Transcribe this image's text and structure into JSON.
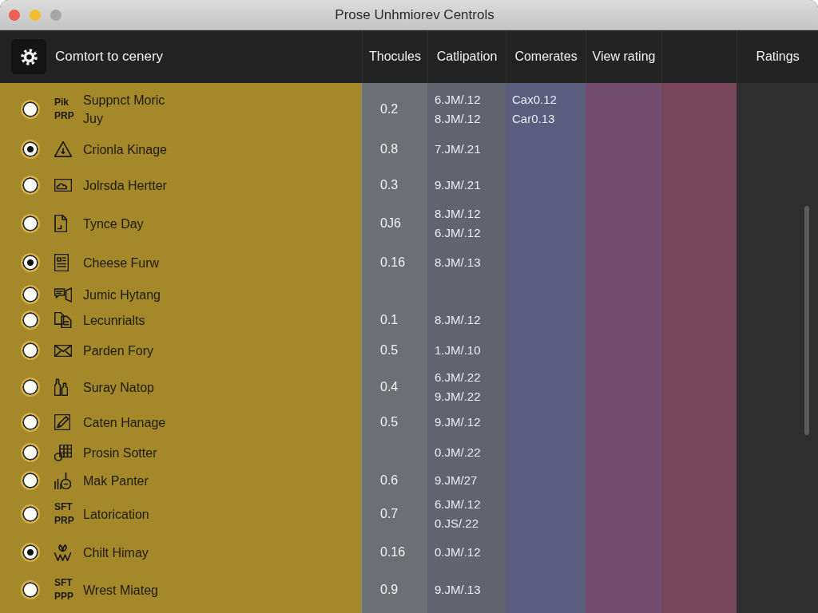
{
  "window": {
    "title": "Prose Unhmiorev Centrols"
  },
  "table": {
    "columns": [
      {
        "label": "Comtort to cenery",
        "color": "#a4882a"
      },
      {
        "label": "Thocules",
        "color": "#6c6f73"
      },
      {
        "label": "Catlipation",
        "color": "#61646f"
      },
      {
        "label": "Comerates",
        "color": "#5a5d7e"
      },
      {
        "label": "View rating",
        "color": "#724c6d"
      },
      {
        "color": "#77465b"
      },
      {
        "label": "Ratings",
        "color": "#2e2e2e"
      }
    ],
    "rows": [
      {
        "selected": false,
        "kind": "abbr",
        "abbr": [
          "Pik",
          "PRP"
        ],
        "name": "Suppnct Moric",
        "note": "Juy",
        "thocules": "0.2",
        "catlipation": [
          "6.JM/.12",
          "8.JM/.12"
        ],
        "comerates": [
          "Cax0.12",
          "Car0.13"
        ]
      },
      {
        "selected": true,
        "kind": "icon",
        "name": "Crionla Kinage",
        "thocules": "0.8",
        "catlipation": [
          "7.JM/.21"
        ]
      },
      {
        "selected": false,
        "kind": "icon",
        "name": "Jolrsda Hertter",
        "thocules": "0.3",
        "catlipation": [
          "9.JM/.21"
        ]
      },
      {
        "selected": false,
        "kind": "icon",
        "name": "Tynce Day",
        "thocules": "0J6",
        "catlipation": [
          "8.JM/.12",
          "6.JM/.12"
        ]
      },
      {
        "selected": true,
        "kind": "icon",
        "name": "Cheese Furw",
        "thocules": "0.16",
        "catlipation": [
          "8.JM/.13"
        ]
      },
      {
        "selected": false,
        "kind": "icon",
        "name": "Jumic Hytang"
      },
      {
        "selected": false,
        "kind": "icon",
        "name": "Lecunrialts",
        "thocules": "0.1",
        "catlipation": [
          "8.JM/.12"
        ]
      },
      {
        "selected": false,
        "kind": "icon",
        "name": "Parden Fory",
        "thocules": "0.5",
        "catlipation": [
          "1.JM/.10"
        ]
      },
      {
        "selected": false,
        "kind": "icon",
        "name": "Suray Natop",
        "thocules": "0.4",
        "catlipation": [
          "6.JM/.22",
          "9.JM/.22"
        ]
      },
      {
        "selected": false,
        "kind": "icon",
        "name": "Caten Hanage",
        "thocules": "0.5",
        "catlipation": [
          "9.JM/.12"
        ]
      },
      {
        "selected": false,
        "kind": "icon",
        "name": "Prosin Sotter",
        "catlipation": [
          "0.JM/.22"
        ]
      },
      {
        "selected": false,
        "kind": "icon",
        "name": "Mak Panter",
        "thocules": "0.6",
        "catlipation": [
          "9.JM/27"
        ]
      },
      {
        "selected": false,
        "kind": "abbr",
        "abbr": [
          "SFT",
          "PRP"
        ],
        "name": "Latorication",
        "thocules": "0.7",
        "catlipation": [
          "6.JM/.12",
          "0.JS/.22"
        ]
      },
      {
        "selected": true,
        "kind": "icon",
        "name": "Chilt Himay",
        "thocules": "0.16",
        "catlipation": [
          "0.JM/.12"
        ]
      },
      {
        "selected": false,
        "kind": "abbr",
        "abbr": [
          "SFT",
          "PPP"
        ],
        "name": "Wrest Miateg",
        "thocules": "0.9",
        "catlipation": [
          "9.JM/.13"
        ]
      }
    ]
  }
}
